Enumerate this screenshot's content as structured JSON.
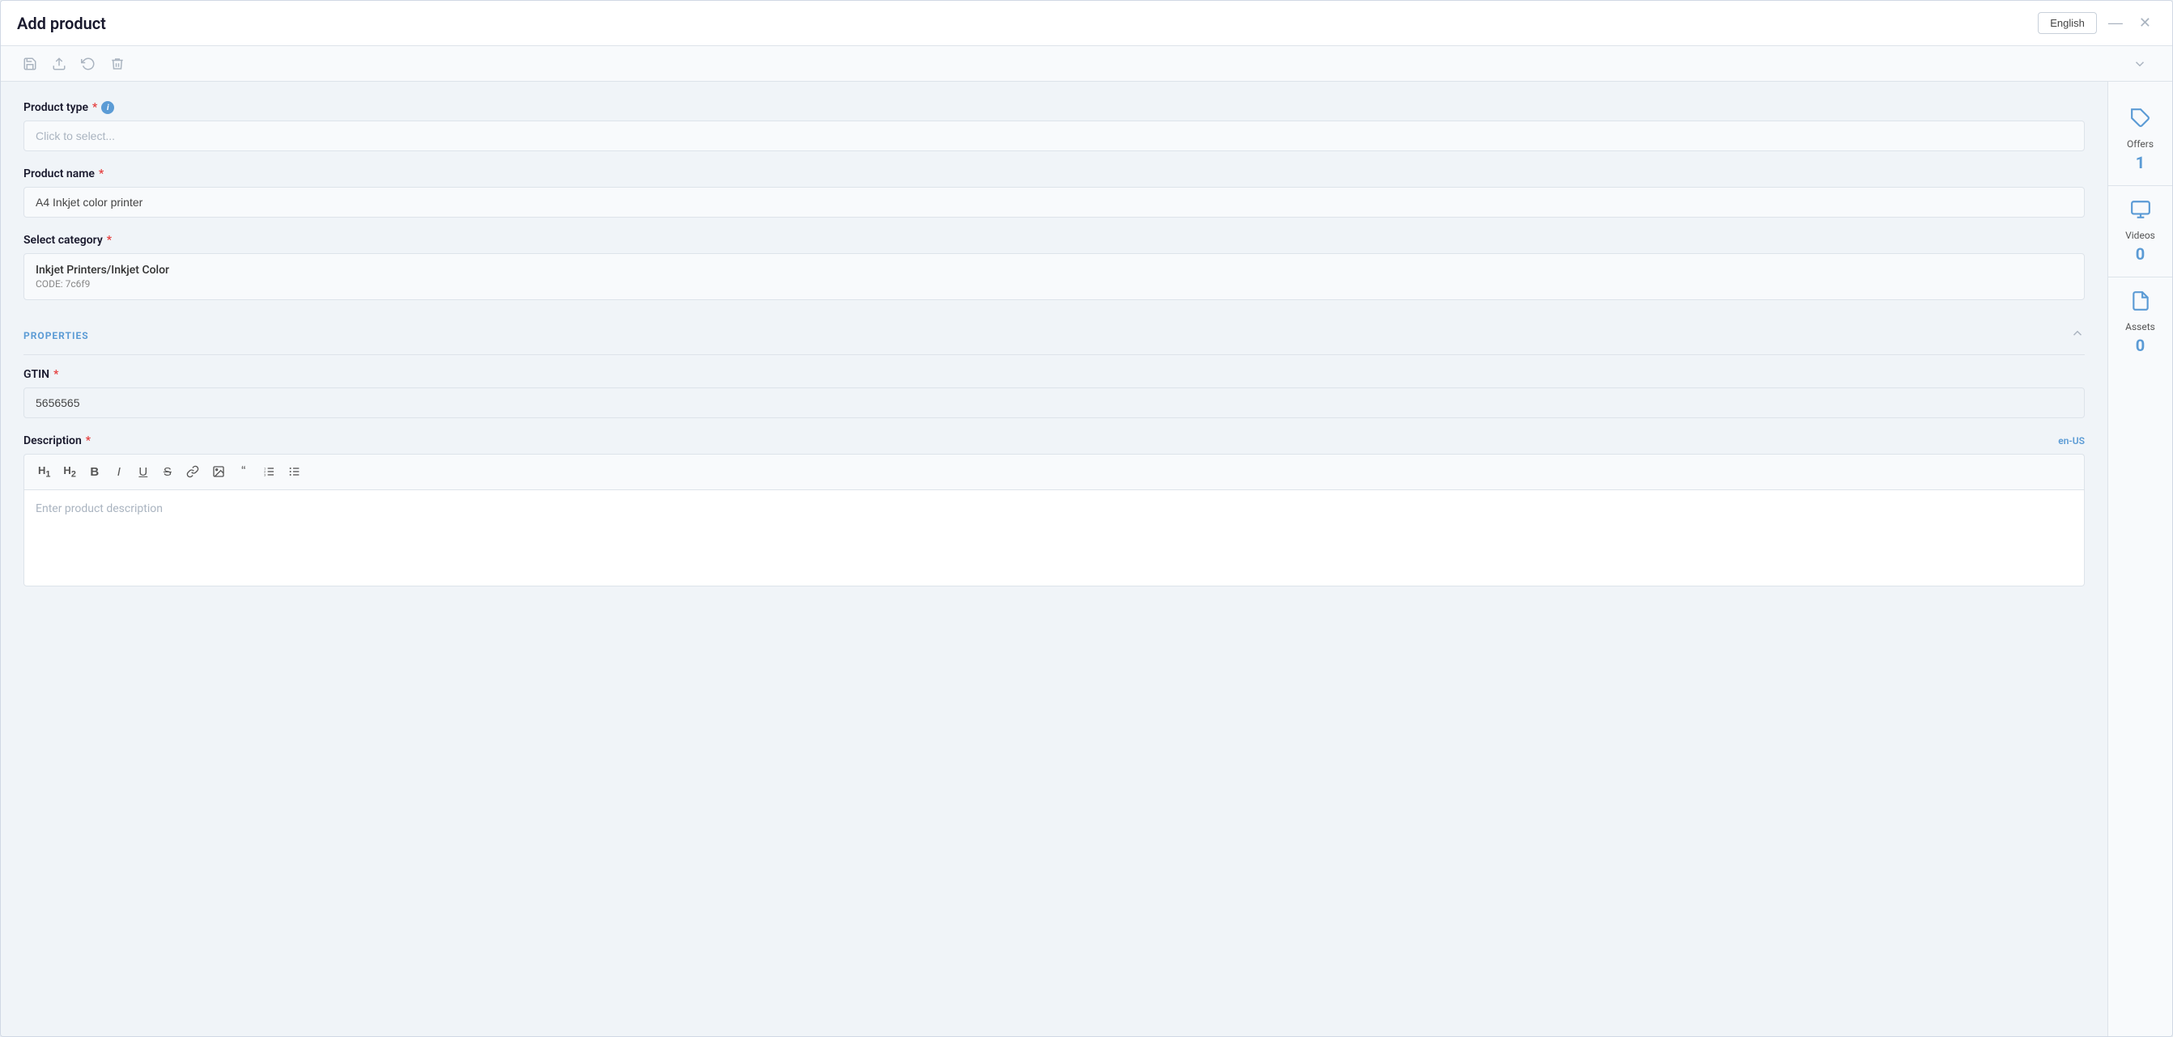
{
  "window": {
    "title": "Add product",
    "lang_button": "English"
  },
  "toolbar": {
    "save_icon": "💾",
    "export_icon": "↗",
    "undo_icon": "↩",
    "delete_icon": "🗑"
  },
  "form": {
    "product_type": {
      "label": "Product type",
      "required": true,
      "has_info": true,
      "placeholder": "Click to select..."
    },
    "product_name": {
      "label": "Product name",
      "required": true,
      "value": "A4 Inkjet color printer"
    },
    "select_category": {
      "label": "Select category",
      "required": true,
      "category_name": "Inkjet Printers/Inkjet Color",
      "category_code": "CODE: 7c6f9"
    },
    "properties": {
      "section_title": "PROPERTIES",
      "gtin": {
        "label": "GTIN",
        "required": true,
        "value": "5656565"
      },
      "description": {
        "label": "Description",
        "required": true,
        "locale": "en-US",
        "placeholder": "Enter product description",
        "editor_buttons": [
          "H1",
          "H2",
          "B",
          "I",
          "U",
          "S",
          "🔗",
          "🖼",
          "❝",
          "ol",
          "ul"
        ]
      }
    }
  },
  "sidebar": {
    "items": [
      {
        "id": "offers",
        "label": "Offers",
        "count": "1",
        "icon": "tag"
      },
      {
        "id": "videos",
        "label": "Videos",
        "count": "0",
        "icon": "video"
      },
      {
        "id": "assets",
        "label": "Assets",
        "count": "0",
        "icon": "file"
      }
    ]
  }
}
